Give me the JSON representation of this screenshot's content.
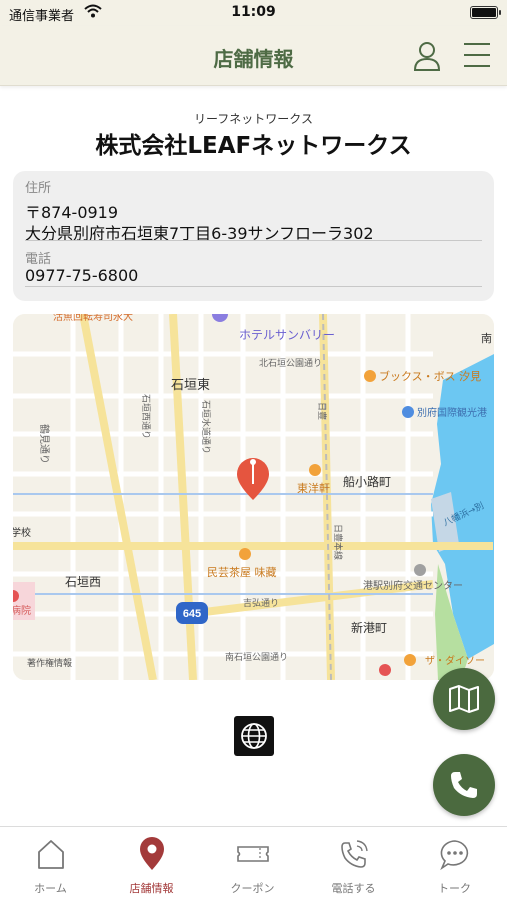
{
  "status_bar": {
    "carrier": "通信事業者",
    "time": "11:09"
  },
  "header": {
    "title": "店舗情報",
    "icons": [
      "user-icon",
      "hamburger-menu-icon"
    ]
  },
  "company": {
    "kana": "リーフネットワークス",
    "name": "株式会社LEAFネットワークス"
  },
  "info": {
    "address_label": "住所",
    "postal_code": "〒874-0919",
    "address": "大分県別府市石垣東7丁目6-39サンフローラ302",
    "phone_label": "電話",
    "phone": "0977-75-6800"
  },
  "map": {
    "labels": {
      "top_partial": "活魚回転寿司永大",
      "hotel": "ホテルサンバリー",
      "park_north": "北石垣公園通り",
      "ishigaki_higashi": "石垣東",
      "ishigaki_nishi_dori": "石垣西通り",
      "ishigaki_suido": "石垣水道通り",
      "tsurumi_dori": "鶴見通り",
      "books": "ブックス・ボス 汐見",
      "port": "別府国際観光港",
      "hiji": "日豊",
      "funakoji": "船小路町",
      "toyoken": "東洋軒",
      "hachiman": "八幡浜→別",
      "school": "学校",
      "mingei": "民芸茶屋 味藏",
      "ishigaki_nishi": "石垣西",
      "hospital": "病院",
      "route_num": "645",
      "yoshihiro": "吉弘通り",
      "kotsu_center": "港駅別府交通センター",
      "nippo_main": "日豊本線",
      "shinminato": "新港町",
      "park_south": "南石垣公園通り",
      "copyright": "著作権情報",
      "the_daiso": "ザ・ダイソー",
      "minami_partial": "南"
    }
  },
  "tabs": [
    {
      "label": "ホーム",
      "icon": "home-icon"
    },
    {
      "label": "店舗情報",
      "icon": "map-pin-icon"
    },
    {
      "label": "クーポン",
      "icon": "ticket-icon"
    },
    {
      "label": "電話する",
      "icon": "phone-icon"
    },
    {
      "label": "トーク",
      "icon": "chat-bubble-icon"
    }
  ],
  "colors": {
    "header_bg": "#f3f1e6",
    "accent_green": "#4b6a3f",
    "active_tab": "#a33a3a",
    "map_pin": "#e5553f"
  }
}
